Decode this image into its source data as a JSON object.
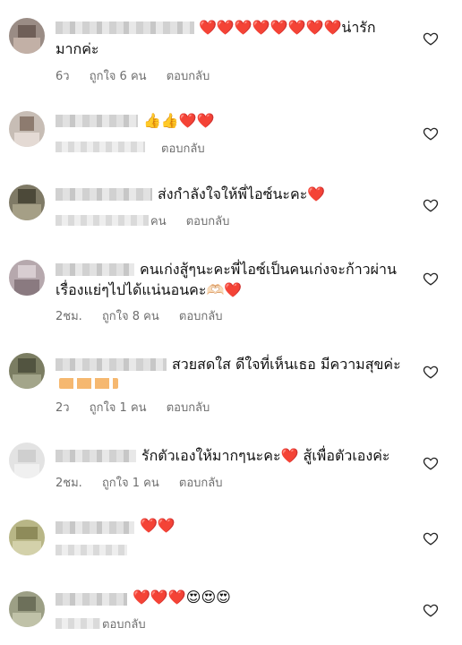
{
  "comments": [
    {
      "text_line1": "❤️❤️❤️❤️❤️❤️❤️❤️น่ารัก",
      "text_line2": "มากค่ะ",
      "age": "6ว",
      "likes": "ถูกใจ 6 คน",
      "reply": "ตอบกลับ"
    },
    {
      "text_line1": "👍👍❤️❤️",
      "text_line2": "",
      "age": "",
      "likes": "",
      "reply": "ตอบกลับ"
    },
    {
      "text_line1": "ส่งกำลังใจให้พี่ไอซ์นะคะ❤️",
      "text_line2": "",
      "age": "",
      "likes": "คน",
      "reply": "ตอบกลับ"
    },
    {
      "text_line1": "คนเก่งสู้ๆนะคะพี่ไอซ์เป็นคนเก่งจะก้าวผ่าน",
      "text_line2": "เรื่องแย่ๆไปได้แน่นอนคะ🫶🏻❤️",
      "age": "2ชม.",
      "likes": "ถูกใจ 8 คน",
      "reply": "ตอบกลับ"
    },
    {
      "text_line1": "สวยสดใส ดีใจที่เห็นเธอ มีความสุขค่ะ",
      "text_line2": "",
      "age": "2ว",
      "likes": "ถูกใจ 1 คน",
      "reply": "ตอบกลับ"
    },
    {
      "text_line1": "รักตัวเองให้มากๆนะคะ❤️ สู้เพื่อตัวเองค่ะ",
      "text_line2": "",
      "age": "2ชม.",
      "likes": "ถูกใจ 1 คน",
      "reply": "ตอบกลับ"
    },
    {
      "text_line1": "❤️❤️",
      "text_line2": "",
      "age": "",
      "likes": "",
      "reply": ""
    },
    {
      "text_line1": "❤️❤️❤️😍😍😍",
      "text_line2": "",
      "age": "",
      "likes": "",
      "reply": "ตอบกลับ"
    }
  ],
  "icons": {
    "like": "heart-outline-icon",
    "avatar": "blurred-avatar"
  },
  "colors": {
    "meta_text": "#6e6e6e",
    "text": "#111111"
  }
}
